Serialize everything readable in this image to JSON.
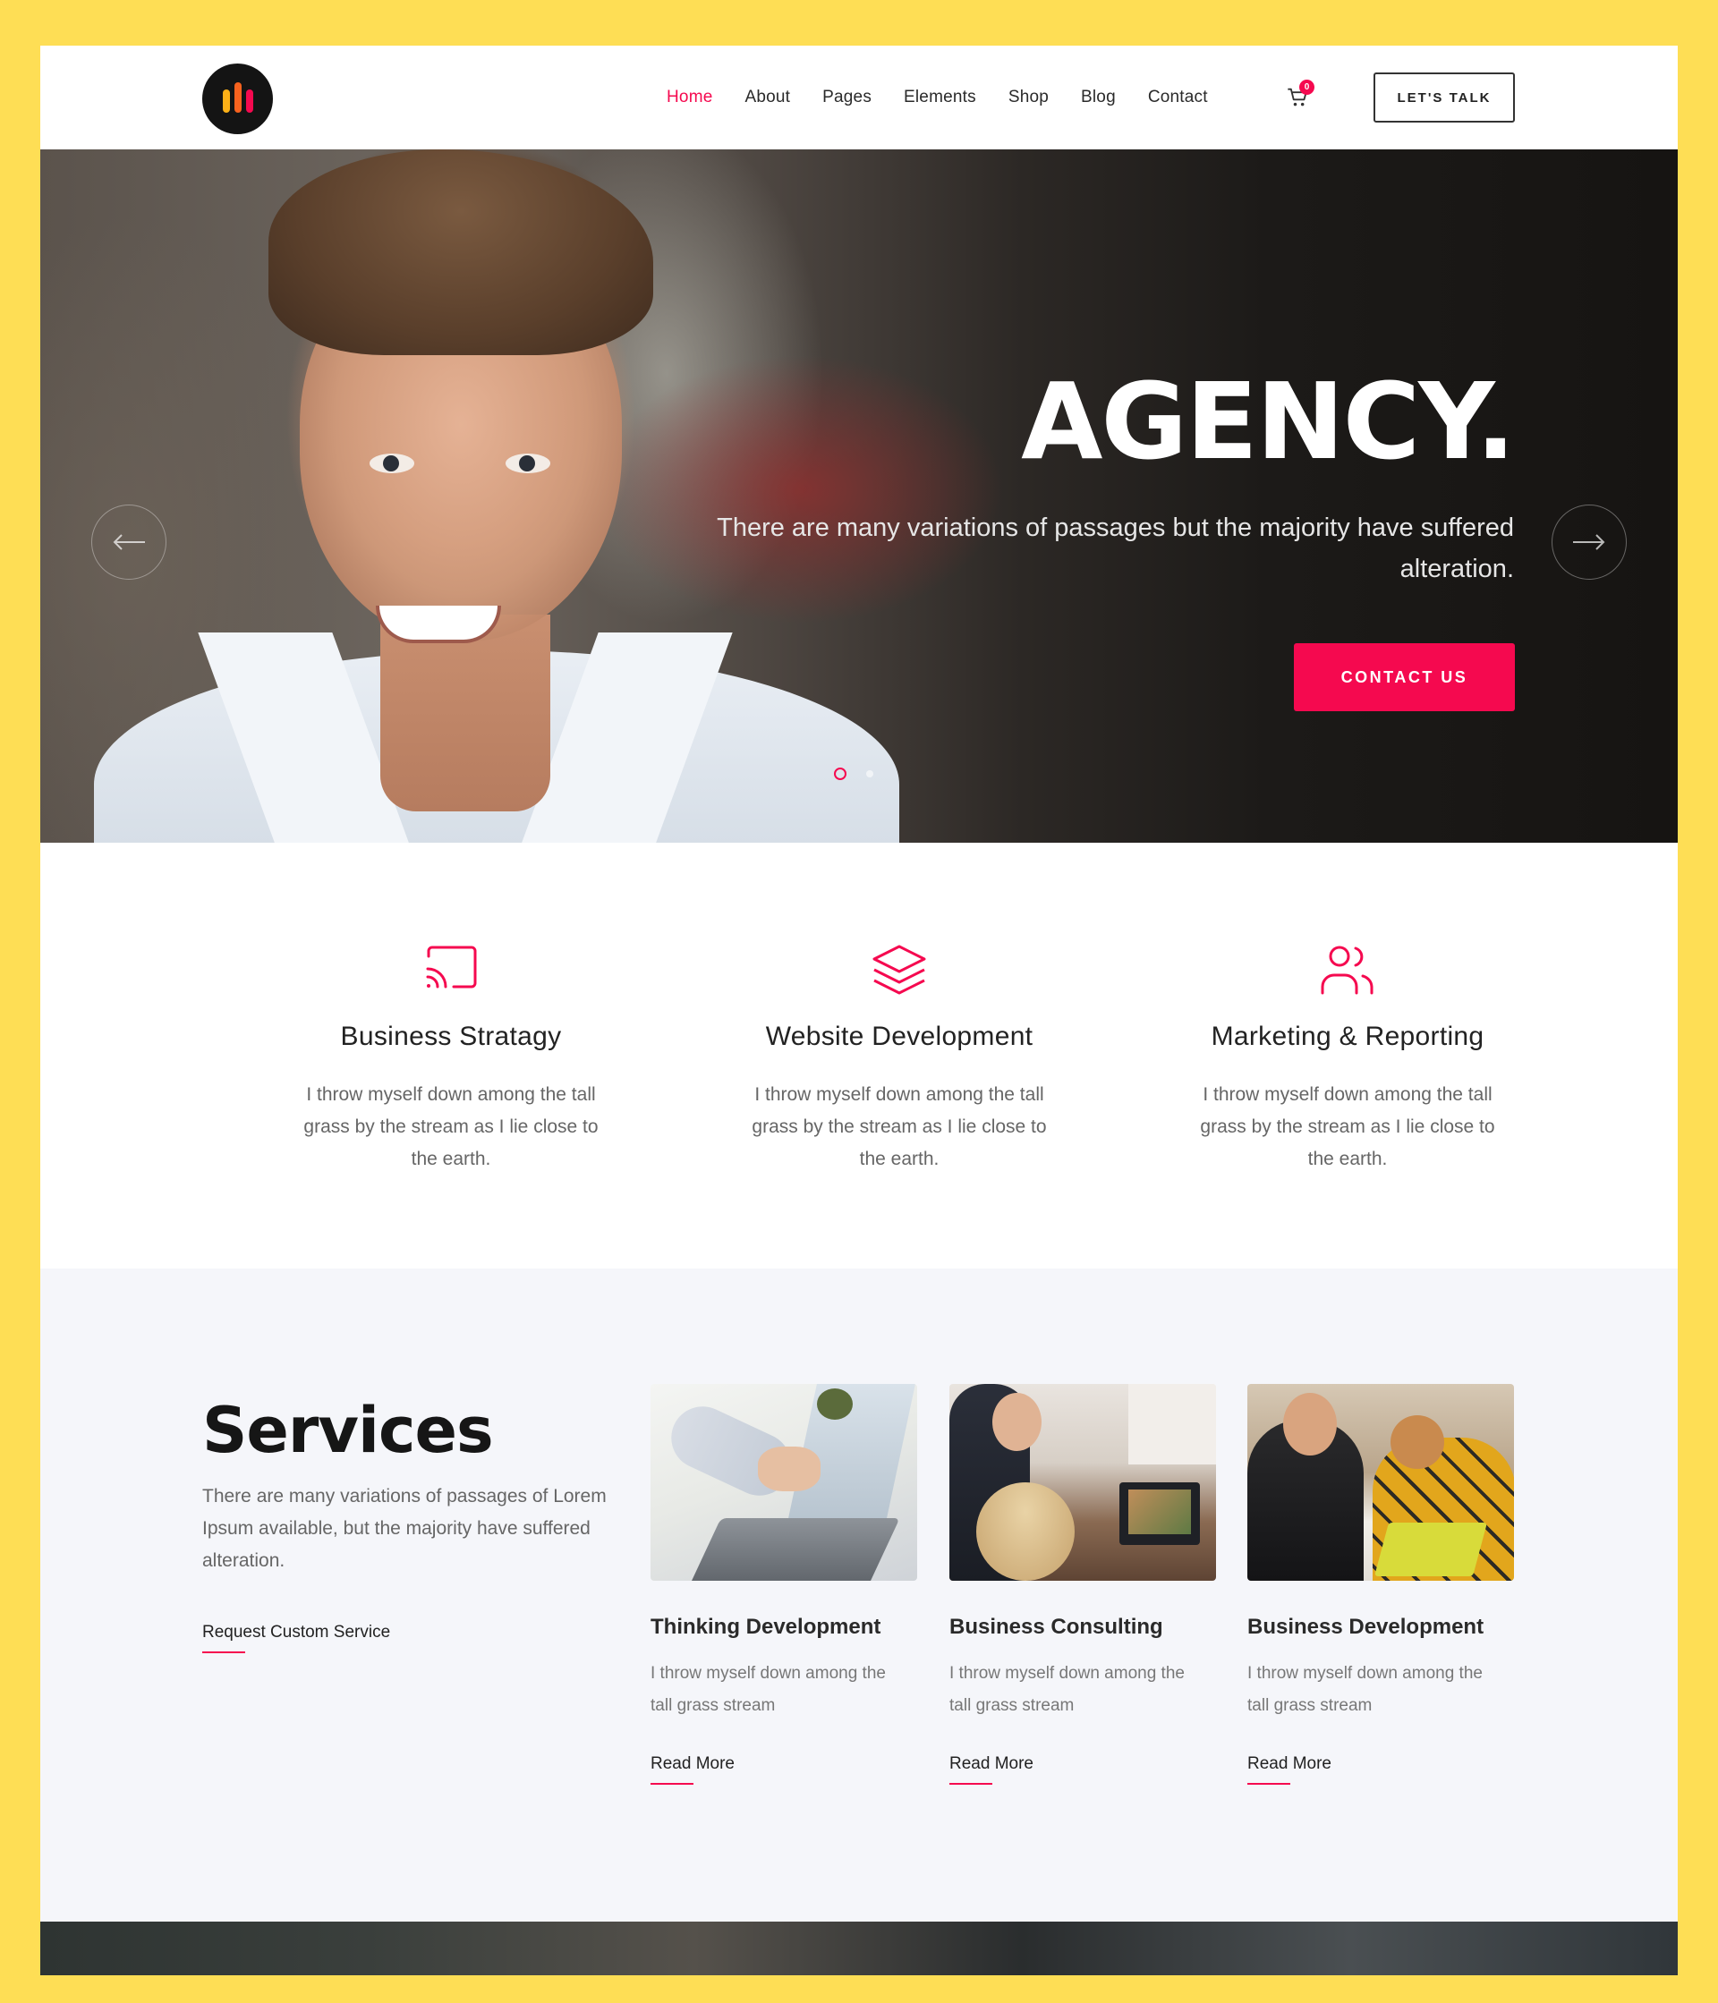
{
  "header": {
    "nav": [
      {
        "label": "Home",
        "active": true
      },
      {
        "label": "About",
        "active": false
      },
      {
        "label": "Pages",
        "active": false
      },
      {
        "label": "Elements",
        "active": false
      },
      {
        "label": "Shop",
        "active": false
      },
      {
        "label": "Blog",
        "active": false
      },
      {
        "label": "Contact",
        "active": false
      }
    ],
    "cart_count": "0",
    "cta_label": "LET'S TALK"
  },
  "hero": {
    "title": "AGENCY.",
    "subtitle": "There are many variations of passages but the majority have suffered alteration.",
    "button_label": "CONTACT US",
    "slide_count": 2,
    "active_slide": 1
  },
  "features": [
    {
      "icon": "cast-icon",
      "title": "Business Stratagy",
      "text": "I throw myself down among the tall grass by the stream as I lie close to the earth."
    },
    {
      "icon": "layers-icon",
      "title": "Website Development",
      "text": "I throw myself down among the tall grass by the stream as I lie close to the earth."
    },
    {
      "icon": "users-icon",
      "title": "Marketing & Reporting",
      "text": "I throw myself down among the tall grass by the stream as I lie close to the earth."
    }
  ],
  "services": {
    "title": "Services",
    "intro": "There are many variations of passages of Lorem Ipsum available, but the majority have suffered alteration.",
    "request_link": "Request Custom Service",
    "cards": [
      {
        "title": "Thinking Development",
        "text": "I throw myself down among the tall grass stream",
        "link": "Read More"
      },
      {
        "title": "Business Consulting",
        "text": "I throw myself down among the tall grass stream",
        "link": "Read More"
      },
      {
        "title": "Business Development",
        "text": "I throw myself down among the tall grass stream",
        "link": "Read More"
      }
    ]
  },
  "colors": {
    "accent": "#f5094f",
    "frame": "#fede55",
    "services_bg": "#f5f6fa"
  }
}
